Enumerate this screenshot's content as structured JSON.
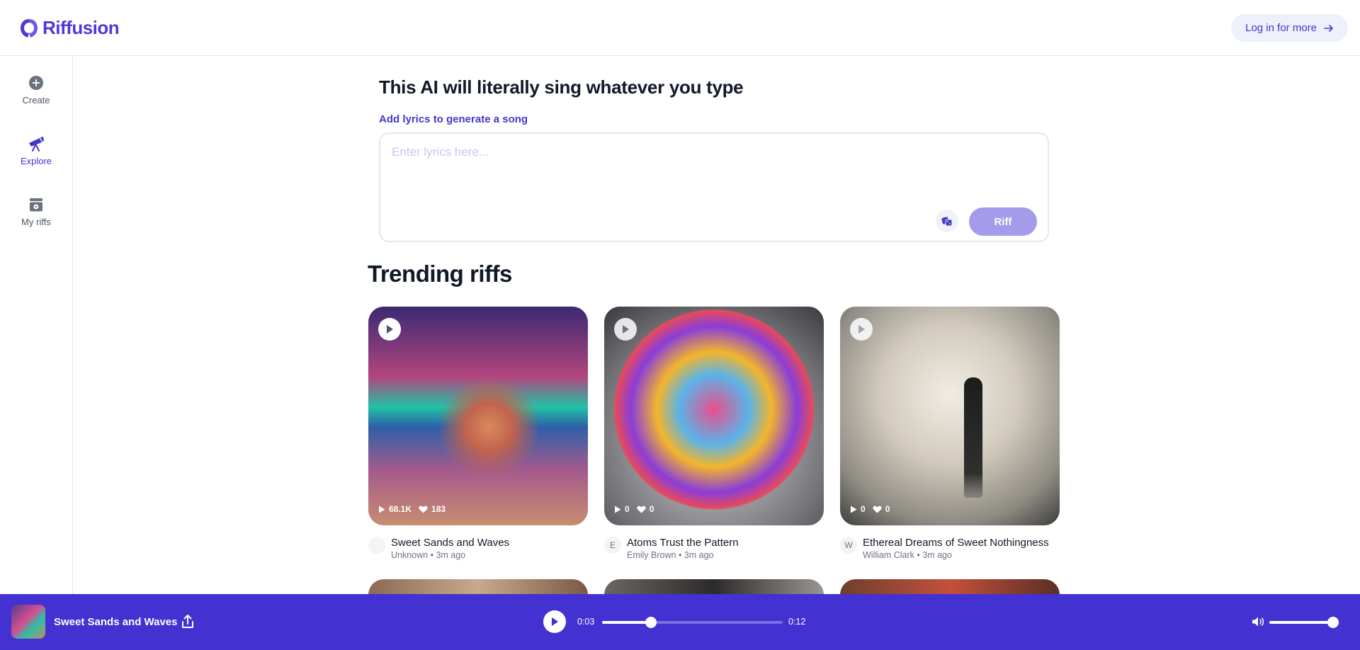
{
  "app": {
    "name": "Riffusion"
  },
  "header": {
    "login_label": "Log in for more"
  },
  "sidebar": {
    "items": [
      {
        "label": "Create",
        "icon": "plus-circle-icon"
      },
      {
        "label": "Explore",
        "icon": "telescope-icon"
      },
      {
        "label": "My riffs",
        "icon": "archive-icon"
      }
    ],
    "active": "Explore"
  },
  "main": {
    "headline": "This AI will literally sing whatever you type",
    "subhead": "Add lyrics to generate a song",
    "lyrics_placeholder": "Enter lyrics here...",
    "lyrics_value": "",
    "riff_label": "Riff",
    "trending_title": "Trending riffs"
  },
  "riffs": [
    {
      "title": "Sweet Sands and Waves",
      "avatar": "",
      "author": "Unknown",
      "age": "3m ago",
      "plays": "68.1K",
      "likes": "183"
    },
    {
      "title": "Atoms Trust the Pattern",
      "avatar": "E",
      "author": "Emily Brown",
      "age": "3m ago",
      "plays": "0",
      "likes": "0"
    },
    {
      "title": "Ethereal Dreams of Sweet Nothingness",
      "avatar": "W",
      "author": "William Clark",
      "age": "3m ago",
      "plays": "0",
      "likes": "0"
    }
  ],
  "player": {
    "title": "Sweet Sands and Waves",
    "current_time": "0:03",
    "duration": "0:12",
    "progress": 0.27,
    "volume": 1.0
  },
  "colors": {
    "accent": "#4331d1",
    "brand": "#4f39d6",
    "riff_button": "#a49bea"
  }
}
